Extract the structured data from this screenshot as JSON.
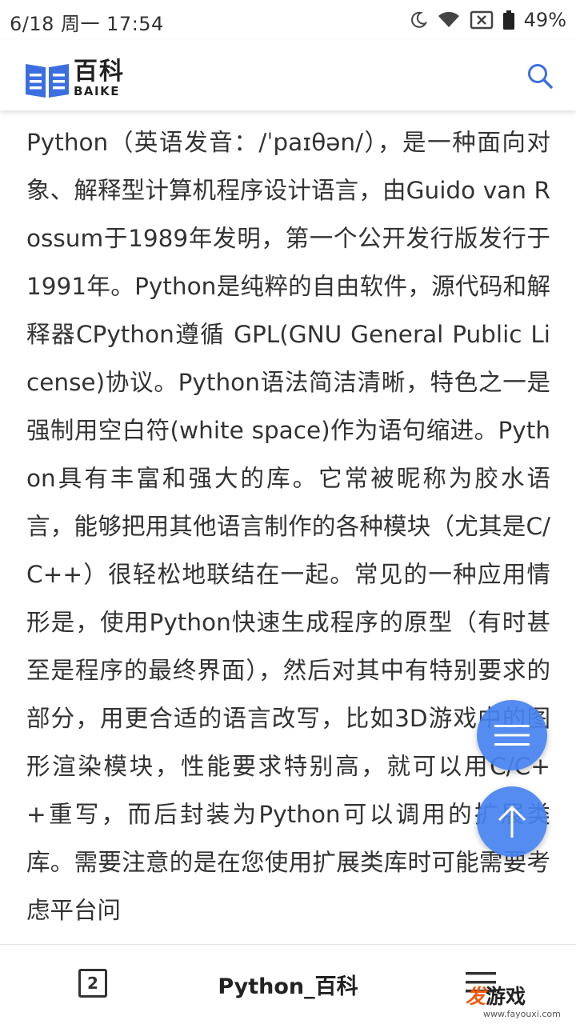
{
  "status_bar": {
    "time": "6/18 周一 17:54",
    "battery": "49%",
    "icons": [
      "moon-icon",
      "wifi-icon",
      "no-sim-icon",
      "battery-icon"
    ]
  },
  "header": {
    "logo_cn": "百科",
    "logo_en": "BAIKE",
    "logo_color": "#3b6fe0",
    "search_icon": "search-icon"
  },
  "article": {
    "text": "Python（英语发音：/ˈpaɪθən/），是一种面向对象、解释型计算机程序设计语言，由Guido van Rossum于1989年发明，第一个公开发行版发行于1991年。Python是纯粹的自由软件，源代码和解释器CPython遵循 GPL(GNU General Public License)协议。Python语法简洁清晰，特色之一是强制用空白符(white space)作为语句缩进。Python具有丰富和强大的库。它常被昵称为胶水语言，能够把用其他语言制作的各种模块（尤其是C/C++）很轻松地联结在一起。常见的一种应用情形是，使用Python快速生成程序的原型（有时甚至是程序的最终界面），然后对其中有特别要求的部分，用更合适的语言改写，比如3D游戏中的图形渲染模块，性能要求特别高，就可以用C/C++重写，而后封装为Python可以调用的扩展类库。需要注意的是在您使用扩展类库时可能需要考虑平台问"
  },
  "fab": {
    "color": "#4682f0",
    "toc_icon": "list-icon",
    "top_icon": "arrow-up-icon"
  },
  "bottom_bar": {
    "tab_count": "2",
    "title": "Python_百科",
    "menu_icon": "menu-icon"
  },
  "watermark": {
    "fa": "发",
    "rest": "游戏",
    "url": "www.fayouxi.com"
  }
}
